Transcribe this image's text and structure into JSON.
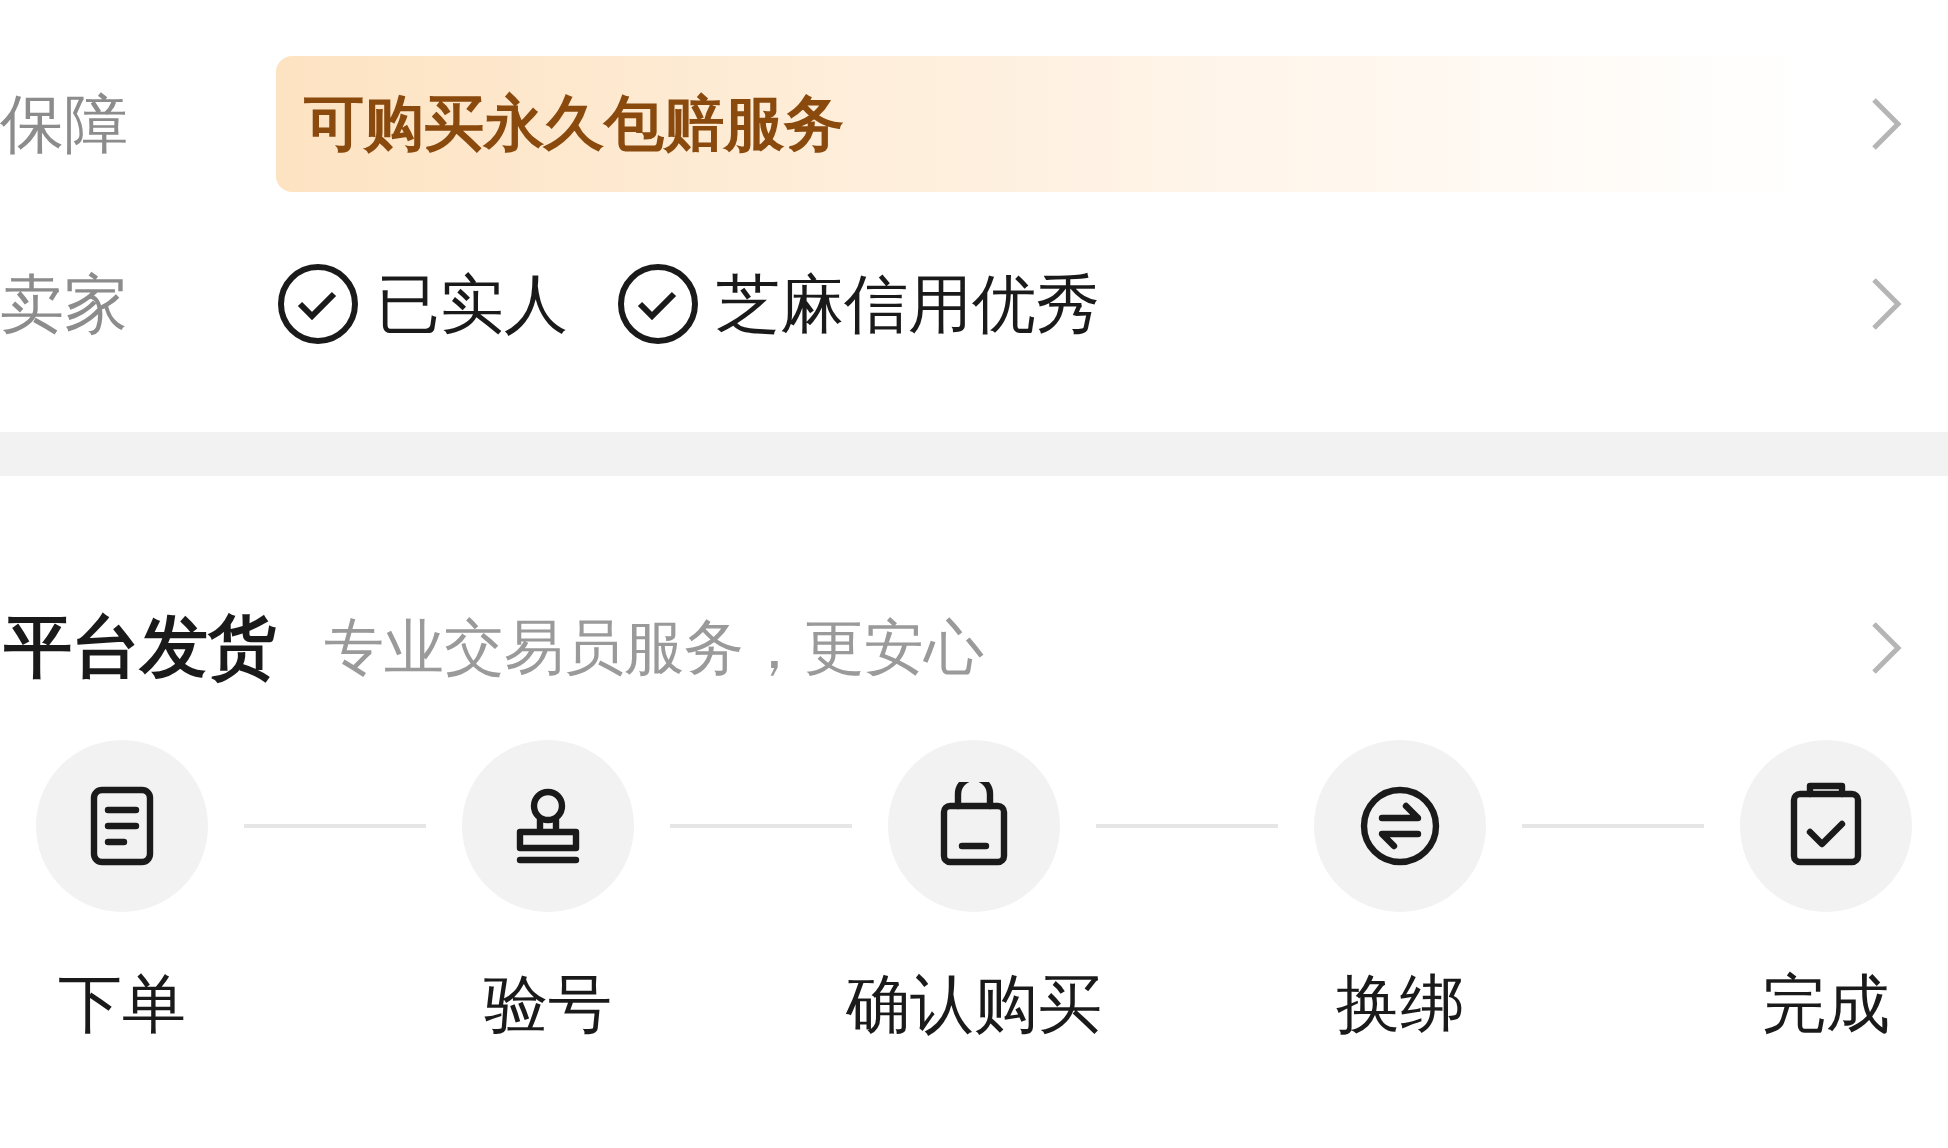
{
  "guarantee": {
    "label": "保障",
    "text": "可购买永久包赔服务"
  },
  "seller": {
    "label": "卖家",
    "badges": [
      "已实人",
      "芝麻信用优秀"
    ]
  },
  "delivery": {
    "title": "平台发货",
    "subtitle": "专业交易员服务，更安心",
    "steps": [
      {
        "kind": "order",
        "label": "下单"
      },
      {
        "kind": "verify",
        "label": "验号"
      },
      {
        "kind": "buy",
        "label": "确认购买"
      },
      {
        "kind": "swap",
        "label": "换绑"
      },
      {
        "kind": "done",
        "label": "完成"
      }
    ]
  }
}
